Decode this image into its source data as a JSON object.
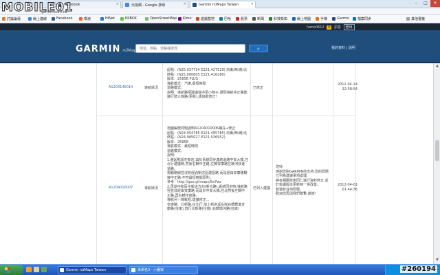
{
  "watermark": {
    "logo": "MOBILE01",
    "url": "garmin.com.tw",
    "id": "#260194"
  },
  "browser": {
    "tabs": [
      {
        "label": "Facebook",
        "color": "#3b5998"
      },
      {
        "label": "元視網 - Google 搜尋",
        "color": "#4285f4"
      },
      {
        "label": "Garmin nüMaps Taiwan",
        "color": "#1f4e7c"
      }
    ],
    "bookmarks": [
      {
        "label": "討論論壇",
        "color": "#e07b2b"
      },
      {
        "label": "線上連線",
        "color": "#3a8de0"
      },
      {
        "label": "Facebook",
        "color": "#3b5998"
      },
      {
        "label": "噗浪",
        "color": "#f26622"
      },
      {
        "label": "HiNet",
        "color": "#2d77c9"
      },
      {
        "label": "KKBOX",
        "color": "#6dbe45"
      },
      {
        "label": "OpenStreetMap",
        "color": "#7ebc6f"
      },
      {
        "label": "Kimo",
        "color": "#7b0099"
      },
      {
        "label": "遊戲基地",
        "color": "#d84315"
      },
      {
        "label": "巴哈",
        "color": "#117e96"
      },
      {
        "label": "股票",
        "color": "#c62828"
      },
      {
        "label": "新聞",
        "color": "#555555"
      },
      {
        "label": "科技新知",
        "color": "#2e7d32"
      },
      {
        "label": "線上地圖",
        "color": "#1565c0"
      },
      {
        "label": "手機",
        "color": "#ef6c00"
      },
      {
        "label": "Garmin",
        "color": "#1f4e7c"
      },
      {
        "label": "檔案同步",
        "color": "#0277bd"
      },
      {
        "label": "其他書籤",
        "color": "#9e9e9e"
      }
    ]
  },
  "header": {
    "username": "fumo0612",
    "count": "0",
    "inbox": "訊息",
    "logout": "登出",
    "brand": "GARMIN",
    "brand_sub": "nüMaps",
    "search_placeholder": "地址、地點、道路或搜尋",
    "links": "我的資料 | 說明"
  },
  "rows": [
    {
      "id": "A1204140014",
      "type": "導航狀況",
      "detail": [
        "起點：(N25.037724 E121.427529) 向東/西/南/北",
        "",
        "終點：(N25.000805 E121.416280)",
        "版本：25858 PLUS",
        "導航模式：汽車,最短時間",
        "道路模式：",
        "說明：導航路徑建議從中至小巷子,請問導航中正路建議行駛三條路(更新),請協助修正!"
      ],
      "status": "已修正",
      "reply": [],
      "date": "2012-04-14",
      "time": "22:58:54"
    },
    {
      "id": "A1204010007",
      "type": "導航狀況",
      "detail": [
        "地圖編號問題說明A1204010006補充+修正",
        "",
        "起點：(N24.954785 E121.495785) 向東/西/南/北",
        "終點：(N24.985027 E121.536952)",
        "版本：25858",
        "導航模式：最短時間",
        "道路模式：",
        "說明：",
        "1.將起點設在新店,由於系統同步連結道路中安大橋,往北行建議時,然後右轉中正路,左轉安康路往環河快速道路。",
        "規劃路線並沒有經過新店區建設路,而是經由安康路轉接中正路,不符最短時間原則。",
        "參考：http://goo.gl/maps/5e7wz",
        "",
        "2.再從中和區往新店方向(新烏路),系統同步時,導航路徑並非經由安康路,而是於中安大橋,往北然後左轉中正路,再右轉市府路。",
        "",
        "導航另一條較短,建議修正...",
        "安康路、北新路,往北行,加上新店溪左岸右轉轉進安康路(往東),直行北新路(往南),右轉環河路(往東)"
      ],
      "status": "已列入建議",
      "reply": [
        "您好,",
        "感謝您對GARMIN的支持,您的問題已列為建議事項處理,",
        "將有相關技術同仁進行資料修正,並於後續版本更新時一併改善。",
        "若還有任何問題,",
        "歡迎您再與我們聯繫,謝謝!"
      ],
      "date": "2012-04-01",
      "time": "01:44:36"
    }
  ],
  "taskbar": {
    "tasks": [
      {
        "label": "Garmin nüMaps Taiwan"
      },
      {
        "label": "未命名3 - 小畫家"
      }
    ]
  }
}
